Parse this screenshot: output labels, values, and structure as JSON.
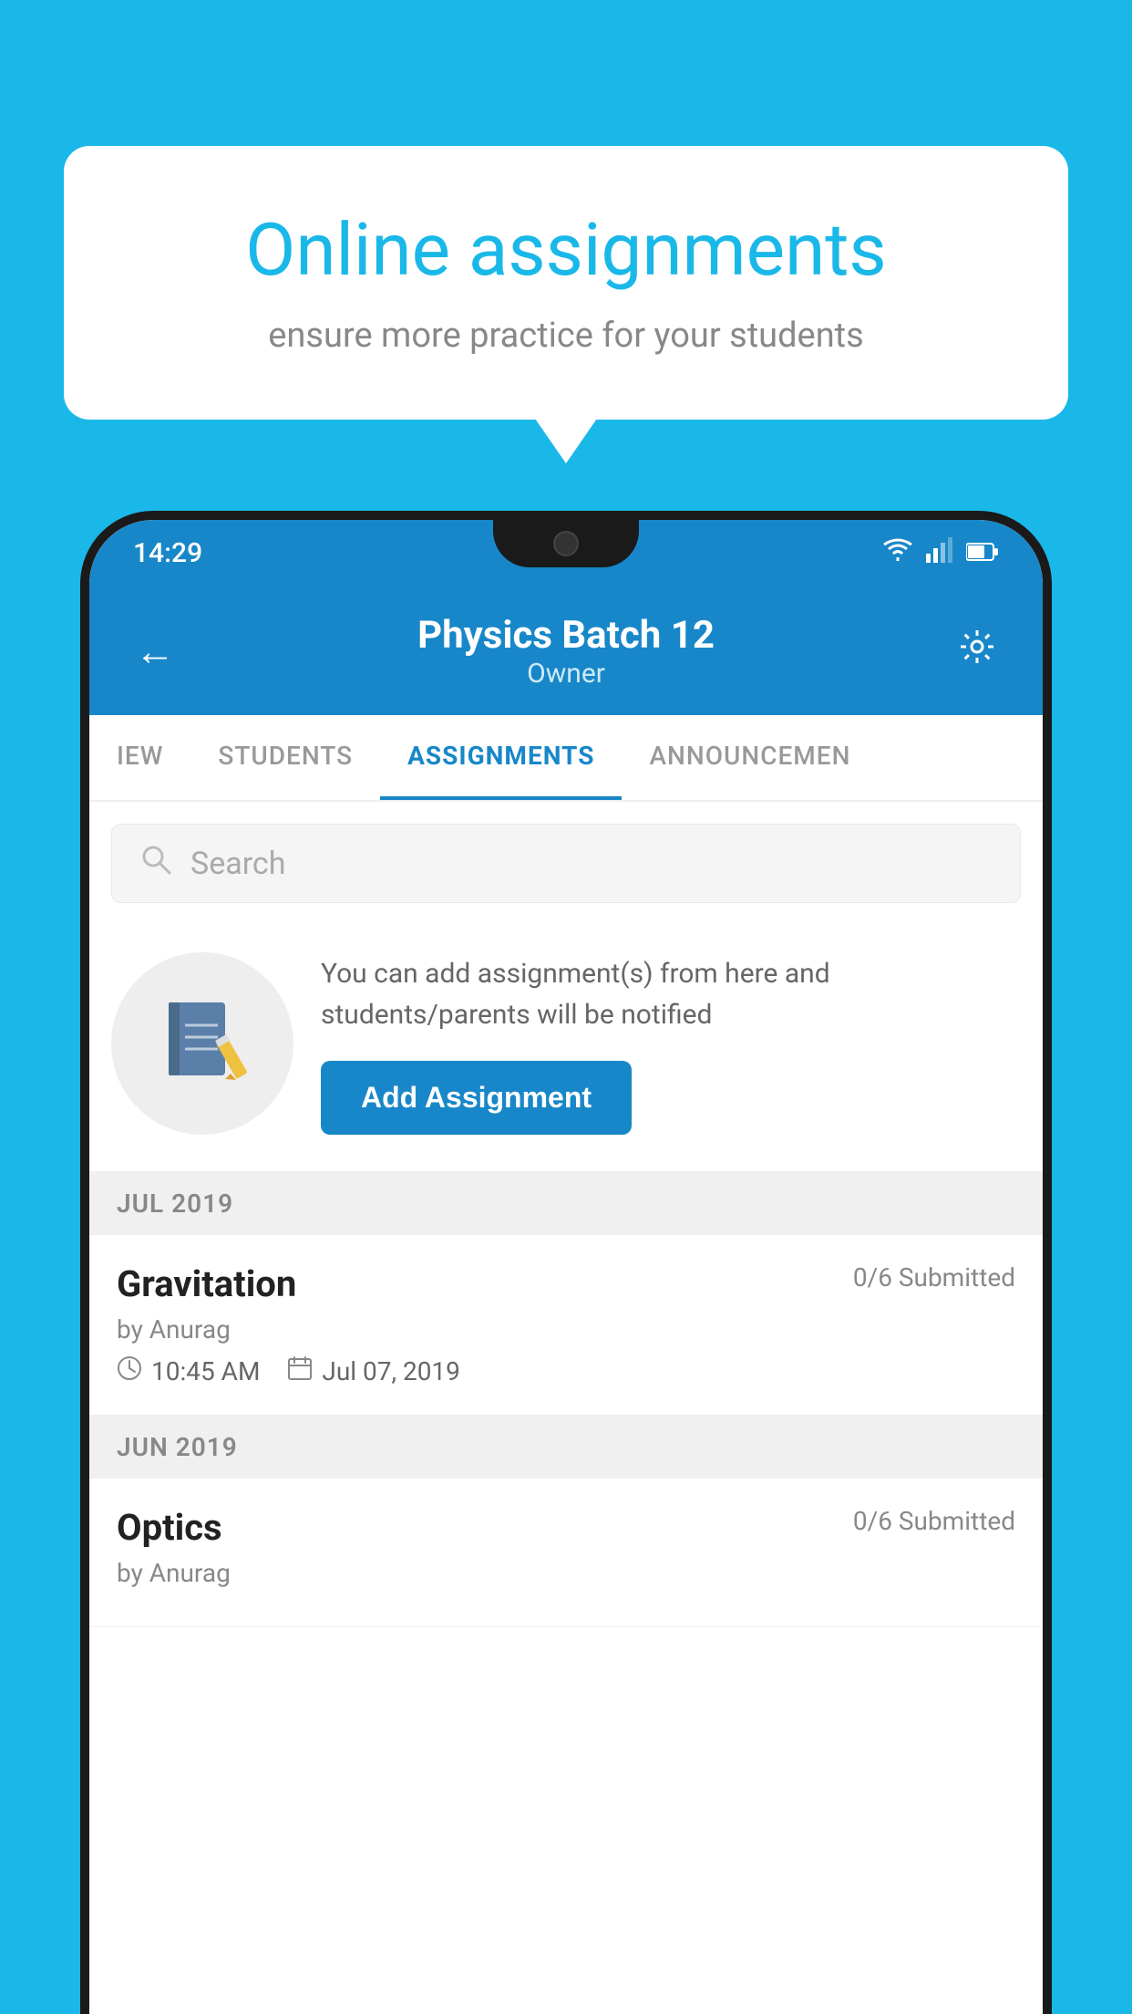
{
  "background_color": "#1ab8e8",
  "promo": {
    "title": "Online assignments",
    "subtitle": "ensure more practice for your students"
  },
  "status_bar": {
    "time": "14:29",
    "icons": [
      "wifi",
      "signal",
      "battery"
    ]
  },
  "header": {
    "title": "Physics Batch 12",
    "subtitle": "Owner",
    "back_label": "←",
    "settings_label": "⚙"
  },
  "tabs": [
    {
      "label": "IEW",
      "active": false
    },
    {
      "label": "STUDENTS",
      "active": false
    },
    {
      "label": "ASSIGNMENTS",
      "active": true
    },
    {
      "label": "ANNOUNCEMENTS",
      "active": false
    }
  ],
  "search": {
    "placeholder": "Search"
  },
  "add_assignment_section": {
    "info_text": "You can add assignment(s) from here and students/parents will be notified",
    "button_label": "Add Assignment"
  },
  "months": [
    {
      "label": "JUL 2019",
      "assignments": [
        {
          "name": "Gravitation",
          "submitted": "0/6 Submitted",
          "by": "by Anurag",
          "time": "10:45 AM",
          "date": "Jul 07, 2019"
        }
      ]
    },
    {
      "label": "JUN 2019",
      "assignments": [
        {
          "name": "Optics",
          "submitted": "0/6 Submitted",
          "by": "by Anurag",
          "time": "",
          "date": ""
        }
      ]
    }
  ]
}
